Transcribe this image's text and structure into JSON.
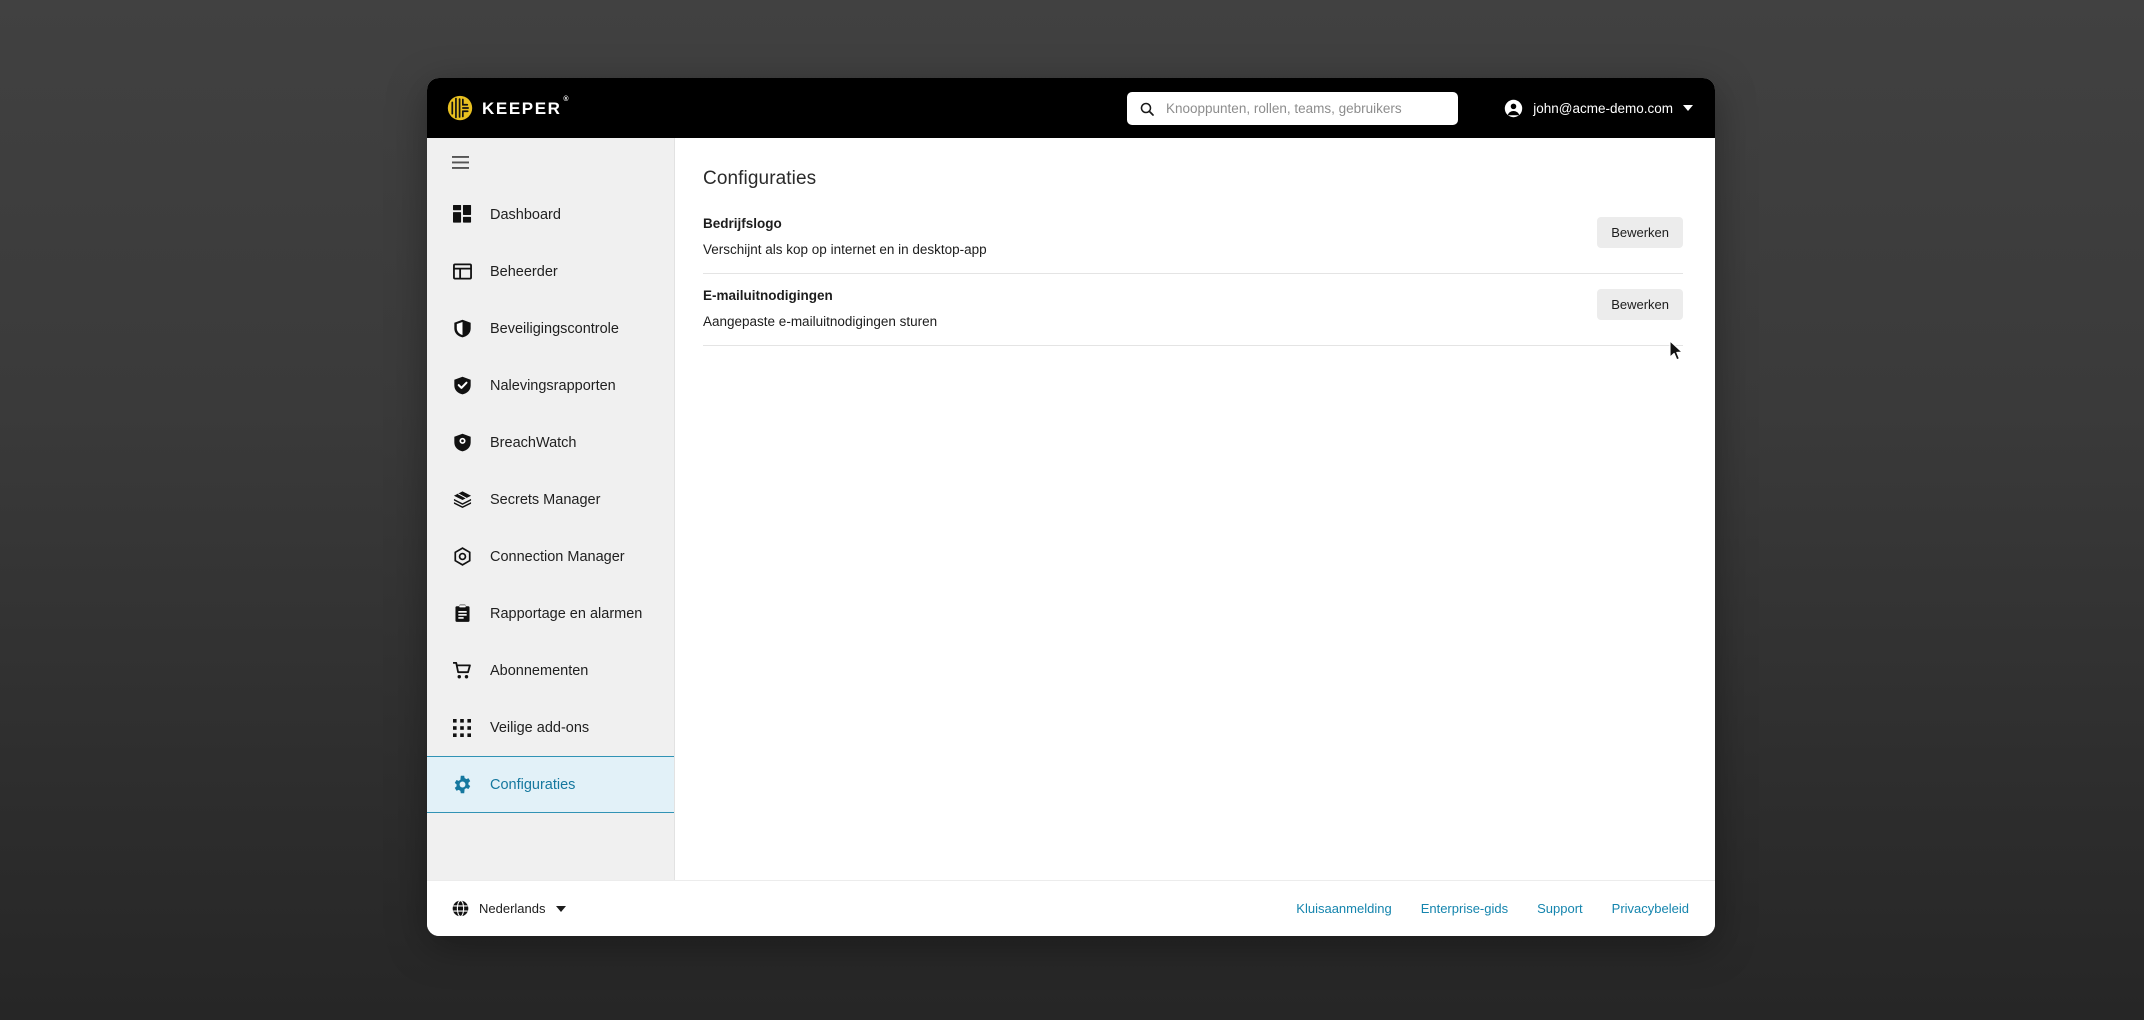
{
  "app": {
    "brand_name": "KEEPER",
    "brand_tm": "®"
  },
  "topbar": {
    "search_placeholder": "Knooppunten, rollen, teams, gebruikers",
    "search_value": "",
    "search_icon": "search-icon",
    "account_email": "john@acme-demo.com",
    "account_icon": "person-circle-icon",
    "account_caret": "chevron-down-icon"
  },
  "sidebar": {
    "menu_icon": "hamburger-menu-icon",
    "items": [
      {
        "label": "Dashboard",
        "icon": "dashboard-grid-icon",
        "active": false
      },
      {
        "label": "Beheerder",
        "icon": "admin-panel-icon",
        "active": false
      },
      {
        "label": "Beveiligingscontrole",
        "icon": "shield-half-icon",
        "active": false
      },
      {
        "label": "Nalevingsrapporten",
        "icon": "shield-check-icon",
        "active": false
      },
      {
        "label": "BreachWatch",
        "icon": "breachwatch-eye-icon",
        "active": false
      },
      {
        "label": "Secrets Manager",
        "icon": "layers-stack-icon",
        "active": false
      },
      {
        "label": "Connection Manager",
        "icon": "hexagon-node-icon",
        "active": false
      },
      {
        "label": "Rapportage en alarmen",
        "icon": "clipboard-report-icon",
        "active": false
      },
      {
        "label": "Abonnementen",
        "icon": "shopping-cart-icon",
        "active": false
      },
      {
        "label": "Veilige add-ons",
        "icon": "apps-grid-icon",
        "active": false
      },
      {
        "label": "Configuraties",
        "icon": "gear-icon",
        "active": true
      }
    ]
  },
  "main": {
    "title": "Configuraties",
    "settings": [
      {
        "name": "Bedrijfslogo",
        "description": "Verschijnt als kop op internet en in desktop-app",
        "button_label": "Bewerken"
      },
      {
        "name": "E-mailuitnodigingen",
        "description": "Aangepaste e-mailuitnodigingen sturen",
        "button_label": "Bewerken"
      }
    ]
  },
  "footer": {
    "language": "Nederlands",
    "language_icon": "globe-icon",
    "language_caret": "chevron-down-icon",
    "links": [
      {
        "label": "Kluisaanmelding"
      },
      {
        "label": "Enterprise-gids"
      },
      {
        "label": "Support"
      },
      {
        "label": "Privacybeleid"
      }
    ]
  },
  "colors": {
    "brand_yellow": "#e8c020",
    "topbar_black": "#000000",
    "sidebar_gray": "#f0f0f0",
    "active_bg": "#e2f1f8",
    "active_text": "#15789f",
    "link_blue": "#1585ae",
    "desktop_bg": "#3a3a3a"
  }
}
